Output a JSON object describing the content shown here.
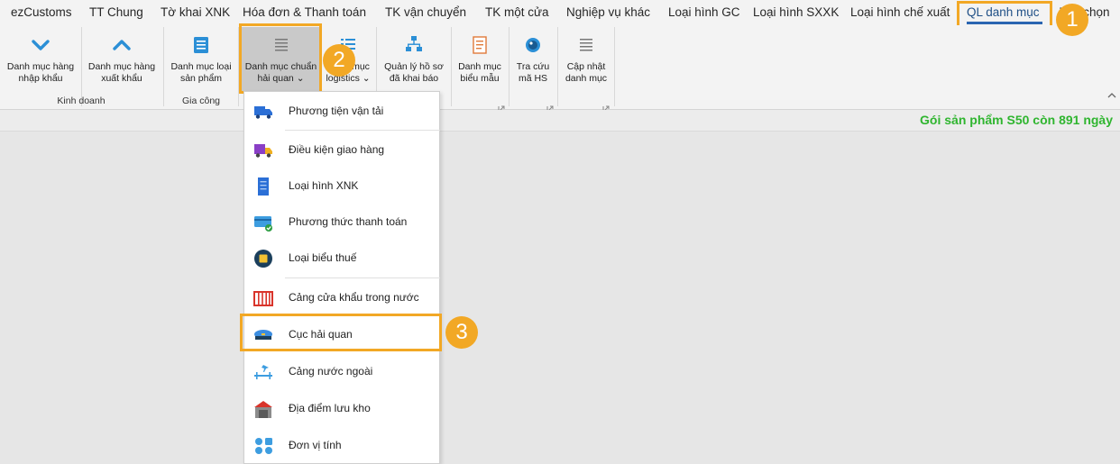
{
  "menu": {
    "tabs": [
      {
        "label": "ezCustoms"
      },
      {
        "label": "TT Chung"
      },
      {
        "label": "Tờ khai XNK"
      },
      {
        "label": "Hóa đơn & Thanh toán"
      },
      {
        "label": "TK vận chuyển"
      },
      {
        "label": "TK một cửa"
      },
      {
        "label": "Nghiệp vụ khác"
      },
      {
        "label": "Loại hình GC"
      },
      {
        "label": "Loại hình SXXK"
      },
      {
        "label": "Loại hình chế xuất"
      },
      {
        "label": "QL danh mục"
      },
      {
        "label": "Tùy chọn"
      }
    ],
    "active_tab": "QL danh mục"
  },
  "ribbon": {
    "buttons": [
      {
        "label": "Danh mục hàng\nnhập khẩu"
      },
      {
        "label": "Danh mục hàng\nxuất khẩu"
      },
      {
        "label": "Danh mục loại\nsản phẩm"
      },
      {
        "label": "Danh mục chuẩn\nhải quan ⌄"
      },
      {
        "label": "Danh mục\nlogistics ⌄"
      },
      {
        "label": "Quản lý hồ sơ\nđã khai báo"
      },
      {
        "label": "Danh mục\nbiểu mẫu"
      },
      {
        "label": "Tra cứu\nmã HS"
      },
      {
        "label": "Cập nhật\ndanh mục"
      }
    ],
    "groups": {
      "kinh_doanh": "Kinh doanh",
      "gia_cong": "Gia công"
    }
  },
  "status": {
    "text": "Gói sản phẩm S50 còn 891 ngày",
    "color": "#2fb52f"
  },
  "dropdown": {
    "items": [
      {
        "label": "Phương tiện vận tải",
        "icon": "truck-icon"
      },
      {
        "label": "Điều kiện giao hàng",
        "icon": "delivery-truck-icon"
      },
      {
        "label": "Loại hình XNK",
        "icon": "document-icon"
      },
      {
        "label": "Phương thức thanh toán",
        "icon": "payment-card-icon"
      },
      {
        "label": "Loại biểu thuế",
        "icon": "tax-coin-icon"
      },
      {
        "label": "Cảng cửa khẩu trong nước",
        "icon": "gate-icon"
      },
      {
        "label": "Cục hải quan",
        "icon": "customs-cap-icon"
      },
      {
        "label": "Cảng nước ngoài",
        "icon": "airport-icon"
      },
      {
        "label": "Địa điểm lưu kho",
        "icon": "warehouse-icon"
      },
      {
        "label": "Đơn vị tính",
        "icon": "units-icon"
      }
    ]
  },
  "callouts": {
    "one": "1",
    "two": "2",
    "three": "3"
  },
  "colors": {
    "accent": "#f2a825",
    "tab_underline": "#2a65b1",
    "icon_blue": "#2b8fd6"
  }
}
